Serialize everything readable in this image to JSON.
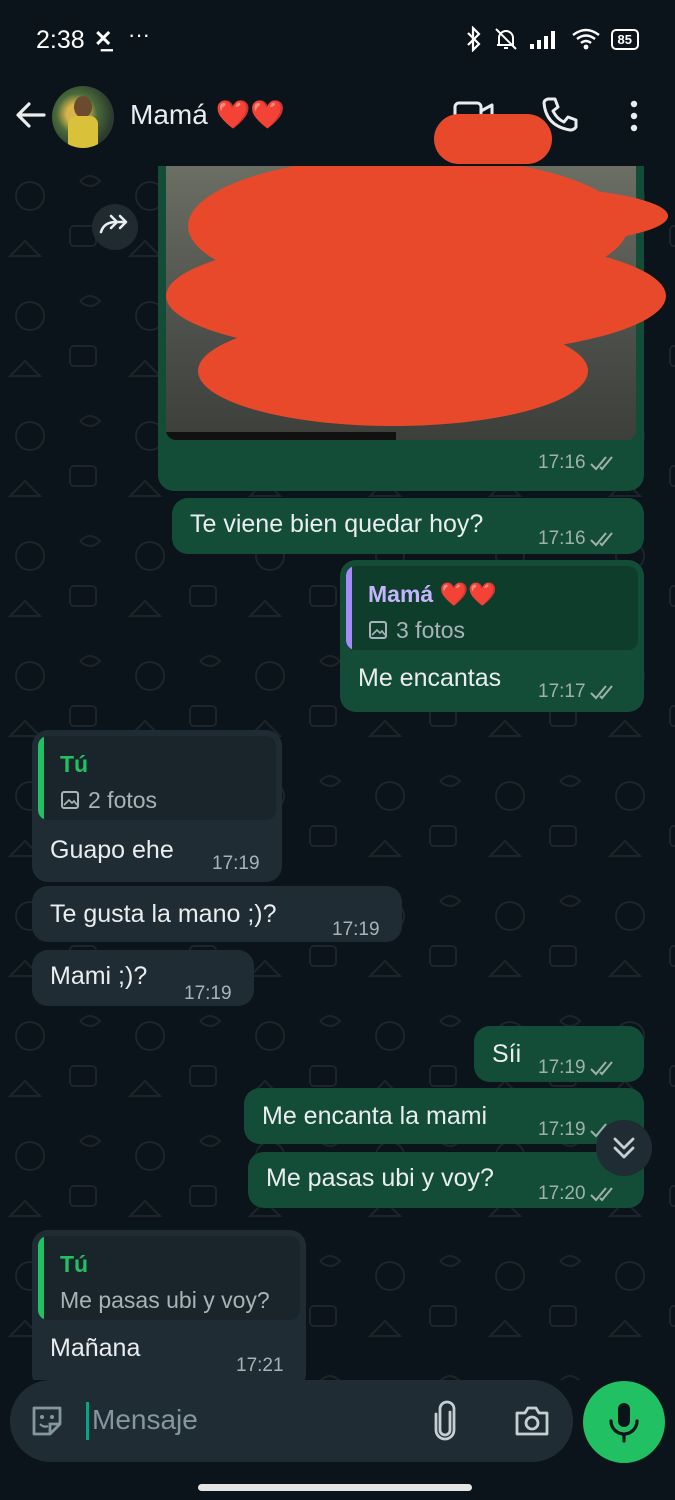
{
  "status_bar": {
    "time": "2:38",
    "more": "···",
    "battery": "85"
  },
  "header": {
    "contact_name": "Mamá ❤️❤️"
  },
  "messages": [
    {
      "id": "m0",
      "direction": "out",
      "type": "image",
      "time": "17:16"
    },
    {
      "id": "m1",
      "direction": "out",
      "text": "Te viene bien quedar hoy?",
      "time": "17:16"
    },
    {
      "id": "m2",
      "direction": "out",
      "quote_name": "Mamá ❤️❤️",
      "quote_text": "3 fotos",
      "text": "Me encantas",
      "time": "17:17"
    },
    {
      "id": "m3",
      "direction": "in",
      "quote_name": "Tú",
      "quote_text": "2 fotos",
      "text": "Guapo ehe",
      "time": "17:19"
    },
    {
      "id": "m4",
      "direction": "in",
      "text": "Te gusta la mano ;)?",
      "time": "17:19"
    },
    {
      "id": "m5",
      "direction": "in",
      "text": "Mami ;)?",
      "time": "17:19"
    },
    {
      "id": "m6",
      "direction": "out",
      "text": "Síi",
      "time": "17:19"
    },
    {
      "id": "m7",
      "direction": "out",
      "text": "Me encanta la mami",
      "time": "17:19"
    },
    {
      "id": "m8",
      "direction": "out",
      "text": "Me pasas ubi y voy?",
      "time": "17:20"
    },
    {
      "id": "m9",
      "direction": "in",
      "quote_name": "Tú",
      "quote_text": "Me pasas ubi y voy?",
      "text": "Mañana",
      "time": "17:21"
    }
  ],
  "composer": {
    "placeholder": "Mensaje"
  },
  "colors": {
    "background": "#0b141a",
    "outgoing_bubble": "#134d37",
    "incoming_bubble": "#202c33",
    "accent_green": "#21c063",
    "read_ticks": "#9fb1ab",
    "redaction": "#e8492a"
  },
  "icons": [
    "back-arrow-icon",
    "video-call-icon",
    "phone-icon",
    "more-vert-icon",
    "forward-icon",
    "image-icon",
    "double-check-icon",
    "chevron-double-down-icon",
    "sticker-icon",
    "attach-icon",
    "camera-icon",
    "mic-icon"
  ]
}
